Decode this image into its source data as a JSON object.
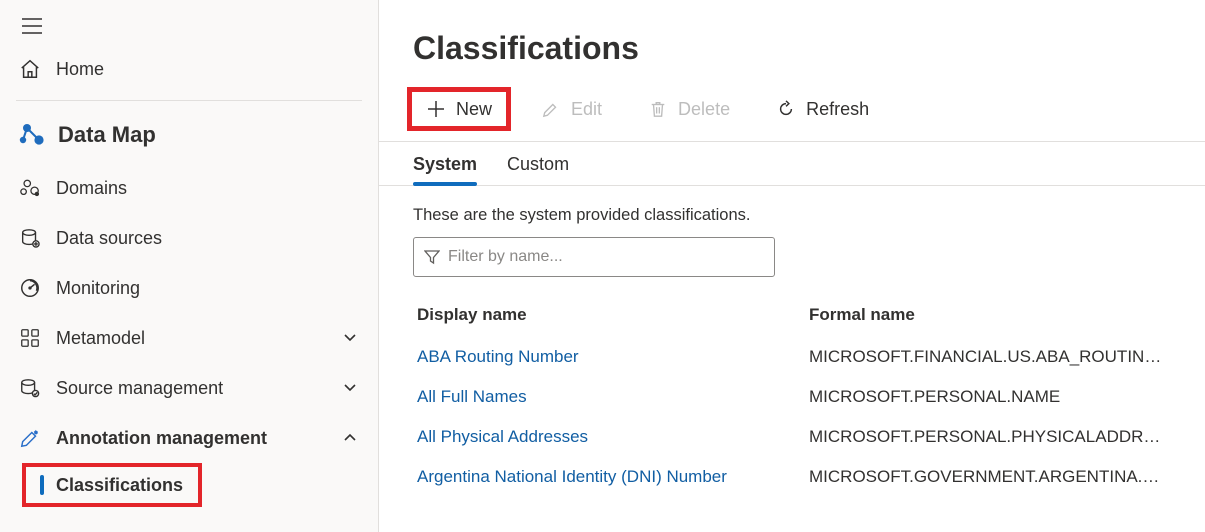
{
  "sidebar": {
    "home": "Home",
    "section": "Data Map",
    "items": [
      {
        "label": "Domains"
      },
      {
        "label": "Data sources"
      },
      {
        "label": "Monitoring"
      },
      {
        "label": "Metamodel"
      },
      {
        "label": "Source management"
      },
      {
        "label": "Annotation management"
      }
    ],
    "sub_selected": "Classifications"
  },
  "page": {
    "title": "Classifications"
  },
  "toolbar": {
    "new_label": "New",
    "edit_label": "Edit",
    "delete_label": "Delete",
    "refresh_label": "Refresh"
  },
  "tabs": {
    "system": "System",
    "custom": "Custom"
  },
  "description": "These are the system provided classifications.",
  "filter": {
    "placeholder": "Filter by name..."
  },
  "table": {
    "columns": {
      "display": "Display name",
      "formal": "Formal name"
    },
    "rows": [
      {
        "display": "ABA Routing Number",
        "formal": "MICROSOFT.FINANCIAL.US.ABA_ROUTING_NU…"
      },
      {
        "display": "All Full Names",
        "formal": "MICROSOFT.PERSONAL.NAME"
      },
      {
        "display": "All Physical Addresses",
        "formal": "MICROSOFT.PERSONAL.PHYSICALADDRESS"
      },
      {
        "display": "Argentina National Identity (DNI) Number",
        "formal": "MICROSOFT.GOVERNMENT.ARGENTINA.DNI_…"
      }
    ]
  }
}
